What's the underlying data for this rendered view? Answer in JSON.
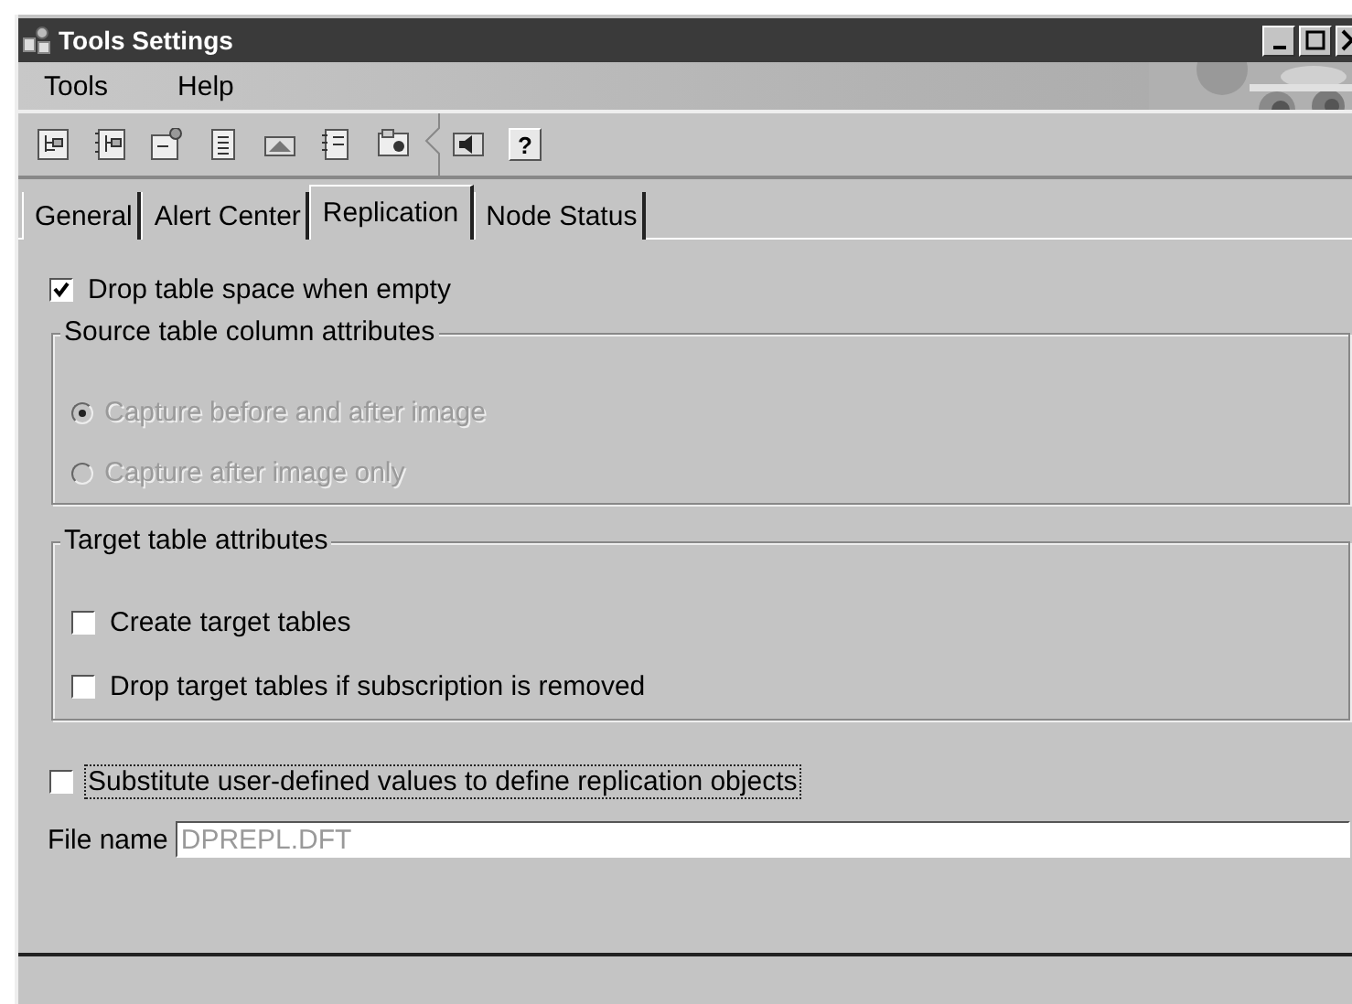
{
  "window": {
    "title": "Tools Settings"
  },
  "menu": [
    "Tools",
    "Help"
  ],
  "toolbar": {
    "help_label": "?"
  },
  "tabs": [
    {
      "label": "General",
      "selected": false
    },
    {
      "label": "Alert Center",
      "selected": false
    },
    {
      "label": "Replication",
      "selected": true
    },
    {
      "label": "Node Status",
      "selected": false
    }
  ],
  "drop_when_empty": {
    "label": "Drop table space when empty",
    "checked": true,
    "focused": false
  },
  "groups": [
    {
      "title": "Source table column attributes",
      "kind": "radio",
      "items": [
        {
          "label": "Capture before and after image",
          "selected": true,
          "disabled": true
        },
        {
          "label": "Capture after image only",
          "selected": false,
          "disabled": true
        }
      ]
    },
    {
      "title": "Target table attributes",
      "kind": "check",
      "items": [
        {
          "label": "Create target tables",
          "checked": false,
          "disabled": false
        },
        {
          "label": "Drop target tables if subscription is removed",
          "checked": false,
          "disabled": false
        }
      ]
    }
  ],
  "substitute": {
    "label": "Substitute user-defined values to define replication objects",
    "checked": false,
    "focused": true
  },
  "file_name": {
    "label": "File name",
    "value": "DPREPL.DFT",
    "disabled": true
  }
}
